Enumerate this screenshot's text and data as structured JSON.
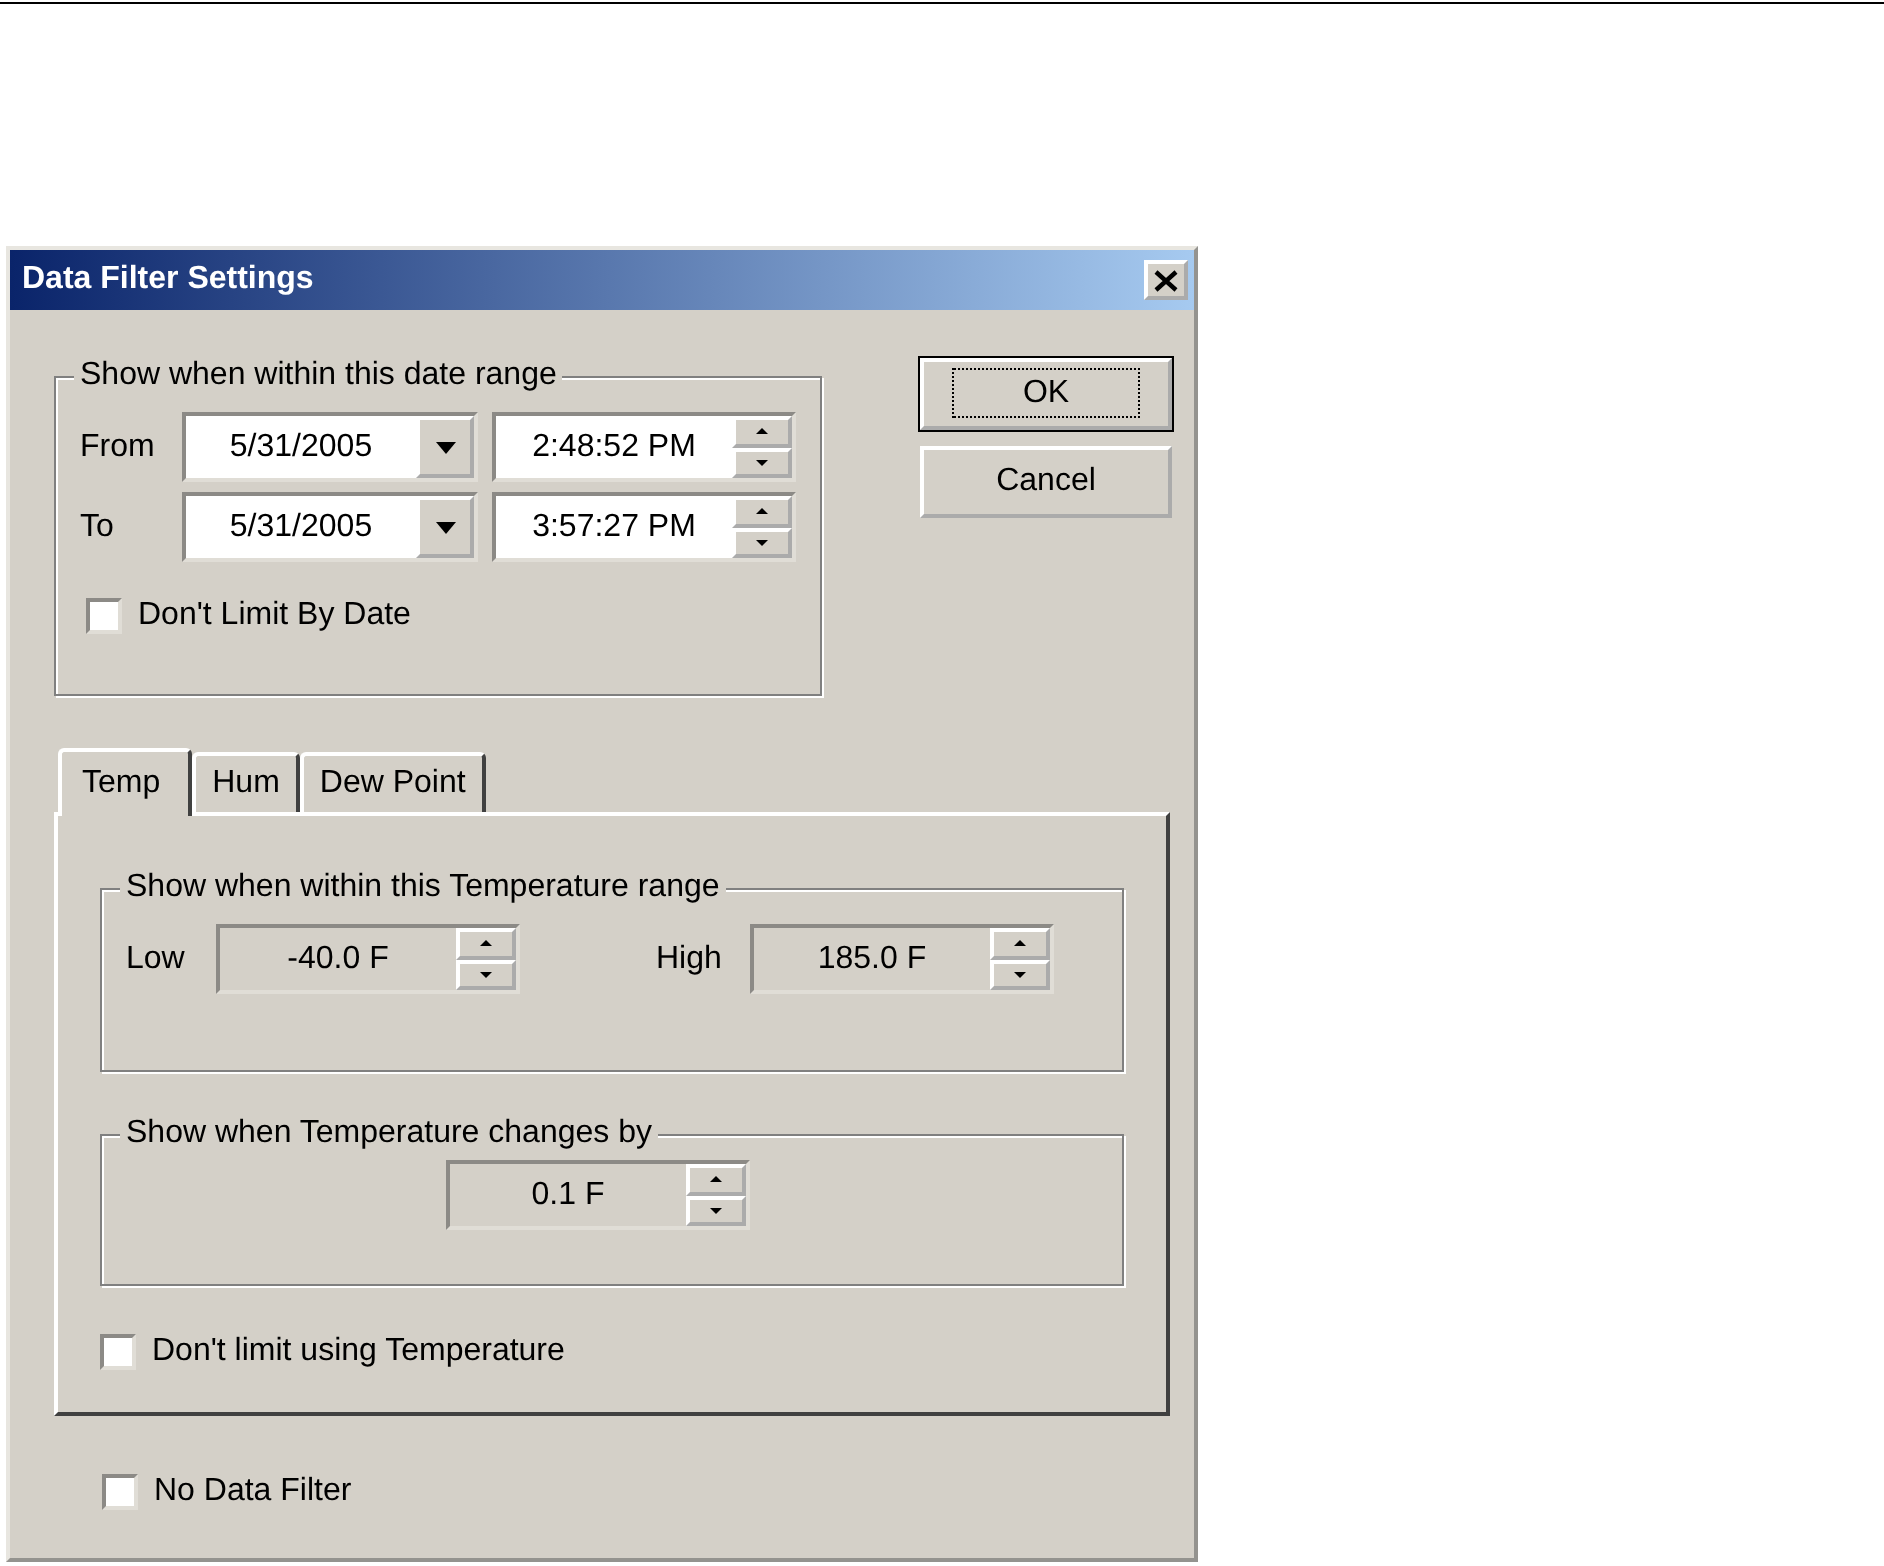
{
  "window": {
    "title": "Data Filter Settings"
  },
  "date_range": {
    "legend": "Show when within this date range",
    "rows": [
      {
        "label": "From",
        "date": "5/31/2005",
        "time": "2:48:52 PM"
      },
      {
        "label": "To",
        "date": "5/31/2005",
        "time": "3:57:27 PM"
      }
    ],
    "dont_limit": {
      "label": "Don't Limit By Date",
      "checked": false
    }
  },
  "buttons": [
    {
      "label": "OK",
      "default": true
    },
    {
      "label": "Cancel",
      "default": false
    }
  ],
  "tabs": [
    {
      "label": "Temp",
      "selected": true
    },
    {
      "label": "Hum",
      "selected": false
    },
    {
      "label": "Dew Point",
      "selected": false
    }
  ],
  "range_group": {
    "legend": "Show when within this Temperature range",
    "fields": [
      {
        "label": "Low",
        "value": "-40.0 F",
        "disabled": true
      },
      {
        "label": "High",
        "value": "185.0 F",
        "disabled": true
      }
    ]
  },
  "change_group": {
    "legend": "Show when Temperature changes by",
    "field": {
      "value": "0.1 F",
      "disabled": true
    }
  },
  "dont_limit_temp": {
    "label": "Don't limit using Temperature",
    "checked": false
  },
  "no_data_filter": {
    "label": "No Data Filter",
    "checked": false
  }
}
